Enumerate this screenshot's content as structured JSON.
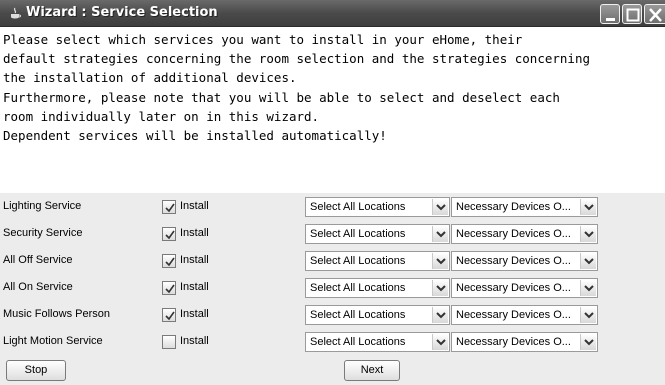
{
  "window": {
    "title": "Wizard : Service Selection"
  },
  "intro": {
    "line1": "Please select which services you want to install in your eHome, their",
    "line2": "default strategies concerning the room selection and the strategies concerning",
    "line3": "the installation of additional devices.",
    "line4": "",
    "line5": "Furthermore, please note that you will be able to select and deselect each",
    "line6": "room individually later on in this wizard.",
    "line7": "",
    "line8": "Dependent services will be installed automatically!"
  },
  "services": [
    {
      "name": "Lighting Service",
      "install_label": "Install",
      "checked": true,
      "location": "Select All Locations",
      "devices": "Necessary Devices O..."
    },
    {
      "name": "Security Service",
      "install_label": "Install",
      "checked": true,
      "location": "Select All Locations",
      "devices": "Necessary Devices O..."
    },
    {
      "name": "All Off Service",
      "install_label": "Install",
      "checked": true,
      "location": "Select All Locations",
      "devices": "Necessary Devices O..."
    },
    {
      "name": "All On Service",
      "install_label": "Install",
      "checked": true,
      "location": "Select All Locations",
      "devices": "Necessary Devices O..."
    },
    {
      "name": "Music Follows Person",
      "install_label": "Install",
      "checked": true,
      "location": "Select All Locations",
      "devices": "Necessary Devices O..."
    },
    {
      "name": "Light Motion Service",
      "install_label": "Install",
      "checked": false,
      "location": "Select All Locations",
      "devices": "Necessary Devices O..."
    }
  ],
  "buttons": {
    "stop": "Stop",
    "next": "Next"
  }
}
